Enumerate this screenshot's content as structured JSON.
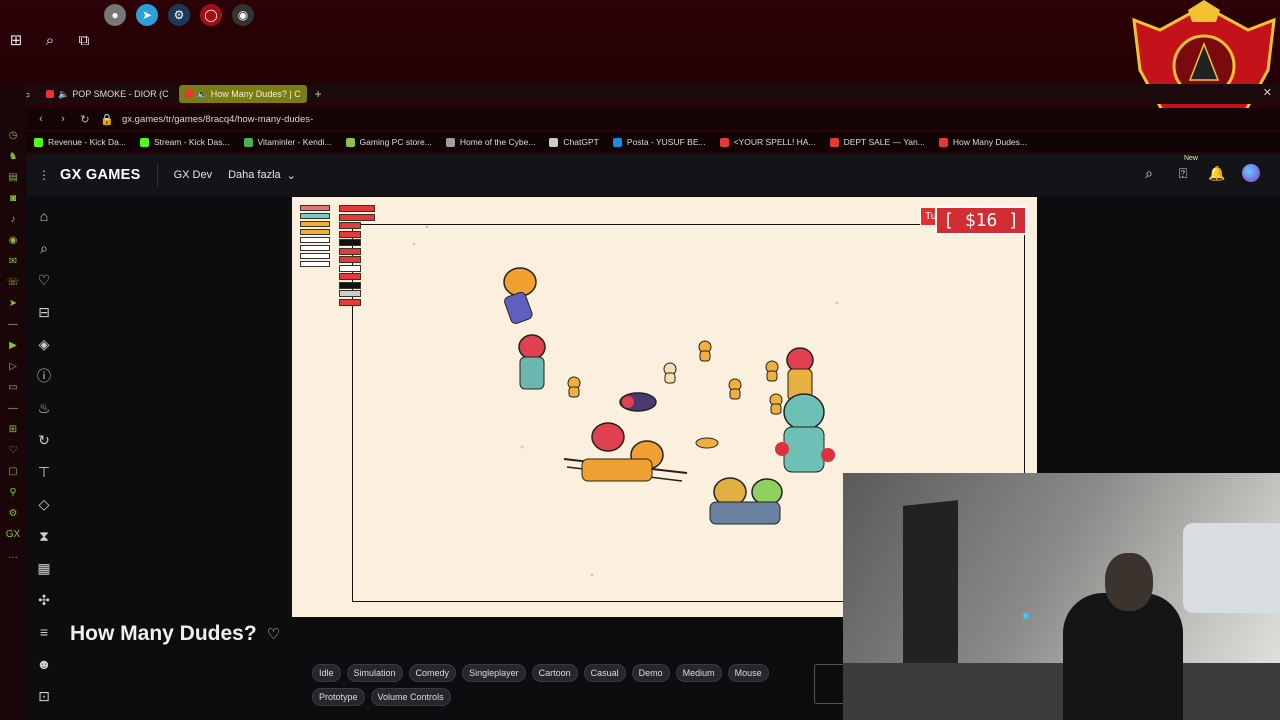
{
  "tabs": [
    {
      "label": "POP SMOKE - DIOR (C",
      "active": false
    },
    {
      "label": "How Many Dudes? | C",
      "active": true
    }
  ],
  "address": {
    "url": "gx.games/tr/games/8racq4/how-many-dudes-"
  },
  "bookmarks": [
    {
      "label": "Revenue - Kick Da...",
      "color": "#53fc18"
    },
    {
      "label": "Stream - Kick Das...",
      "color": "#53fc18"
    },
    {
      "label": "Vitaminler - Kendi...",
      "color": "#4caf50"
    },
    {
      "label": "Gaming PC store...",
      "color": "#8bc34a"
    },
    {
      "label": "Home of the Cybe...",
      "color": "#9e9e9e"
    },
    {
      "label": "ChatGPT",
      "color": "#cccccc"
    },
    {
      "label": "Posta - YUSUF BE...",
      "color": "#1e88e5"
    },
    {
      "label": "<YOUR SPELL! HA...",
      "color": "#e53935"
    },
    {
      "label": "DEPT SALE — Yan...",
      "color": "#e53935"
    },
    {
      "label": "How Many Dudes...",
      "color": "#e53935"
    }
  ],
  "header": {
    "logo": "GX GAMES",
    "links": [
      "GX Dev",
      "Daha fazla"
    ],
    "new_badge": "New"
  },
  "game": {
    "turbo": "Turbo",
    "money": "[ $16 ]"
  },
  "page": {
    "title": "How Many Dudes?"
  },
  "tags": [
    "Idle",
    "Simulation",
    "Comedy",
    "Singleplayer",
    "Cartoon",
    "Casual",
    "Demo",
    "Medium",
    "Mouse",
    "Prototype",
    "Volume Controls"
  ],
  "colors": {
    "accent": "#7a7c14",
    "danger": "#d32d34",
    "gx_green": "#8fbf3a"
  }
}
